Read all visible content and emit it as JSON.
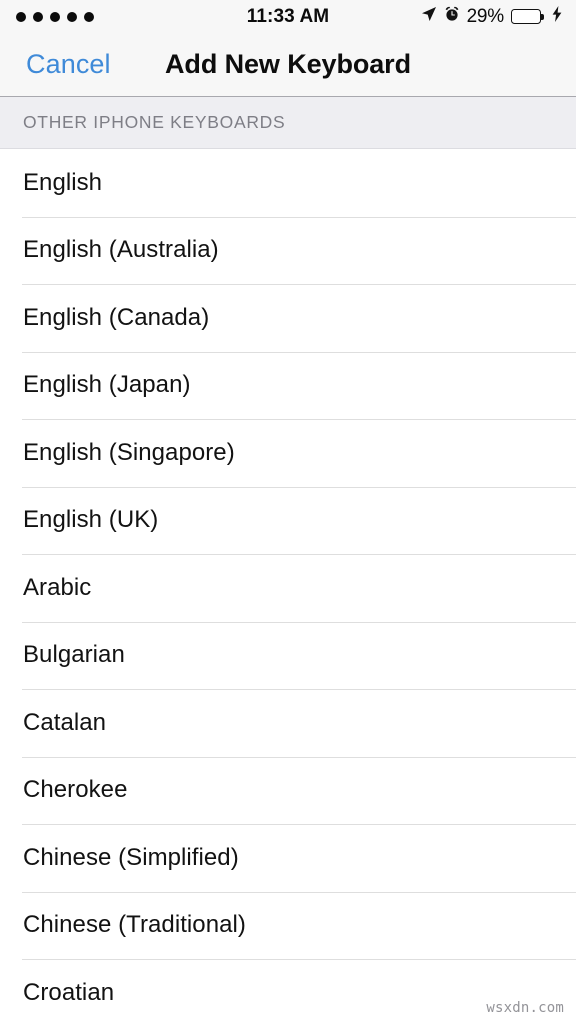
{
  "status_bar": {
    "signal_dots": 5,
    "time": "11:33 AM",
    "battery_percent_label": "29%",
    "battery_level": 29,
    "battery_color": "#ffcc00",
    "icons": [
      "location-arrow-icon",
      "alarm-clock-icon",
      "battery-icon",
      "lightning-bolt-icon"
    ]
  },
  "nav_bar": {
    "cancel_label": "Cancel",
    "title": "Add New Keyboard",
    "tint_color": "#3f8ad8"
  },
  "section": {
    "header": "Other iPhone Keyboards"
  },
  "keyboards": [
    {
      "label": "English"
    },
    {
      "label": "English (Australia)"
    },
    {
      "label": "English (Canada)"
    },
    {
      "label": "English (Japan)"
    },
    {
      "label": "English (Singapore)"
    },
    {
      "label": "English (UK)"
    },
    {
      "label": "Arabic"
    },
    {
      "label": "Bulgarian"
    },
    {
      "label": "Catalan"
    },
    {
      "label": "Cherokee"
    },
    {
      "label": "Chinese (Simplified)"
    },
    {
      "label": "Chinese (Traditional)"
    },
    {
      "label": "Croatian"
    }
  ],
  "watermark": "wsxdn.com"
}
